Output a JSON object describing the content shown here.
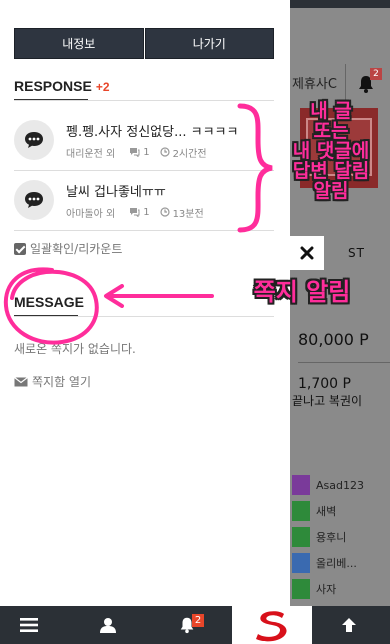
{
  "colors": {
    "drawer_bg": "#ffffff",
    "button_dark": "#2e3540",
    "badge_orange": "#e8462a",
    "annotation_pink": "#ff2d9b",
    "bottom_bar": "#2b3036"
  },
  "drawer": {
    "buttons": {
      "myinfo": "내정보",
      "logout": "나가기"
    },
    "response": {
      "title": "RESPONSE",
      "badge": "+2",
      "items": [
        {
          "title": "펭.펭.사자 정신없당... ㅋㅋㅋㅋ",
          "author": "대리운전 외",
          "comments": "1",
          "time": "2시간전",
          "icon": "comment-icon"
        },
        {
          "title": "날씨 겁나좋네ㅠㅠ",
          "author": "아마돌아 외",
          "comments": "1",
          "time": "13분전",
          "icon": "comment-icon"
        }
      ],
      "mark_all": "일괄확인/리카운트"
    },
    "message": {
      "title": "MESSAGE",
      "empty_text": "새로온 쪽지가 없습니다.",
      "open_label": "쪽지함 열기"
    }
  },
  "annotations": {
    "reply_alert": [
      "내 글",
      "또는",
      "내 댓글에",
      "답변 달림",
      "알림"
    ],
    "message_alert": "쪽지 알림"
  },
  "background": {
    "tab_label": "제휴사C",
    "notif_count": "2",
    "best_label": "ST",
    "price": "80,000 P",
    "price2": "1,700 P",
    "news": "끝나고 복권이",
    "users": [
      "Asad123",
      "새벽",
      "용후니",
      "올리베...",
      "사자"
    ]
  },
  "bottom_nav": {
    "items": [
      "menu-icon",
      "user-icon",
      "bell-icon",
      "logo",
      "arrow-up-icon"
    ],
    "notif_badge": "2"
  }
}
